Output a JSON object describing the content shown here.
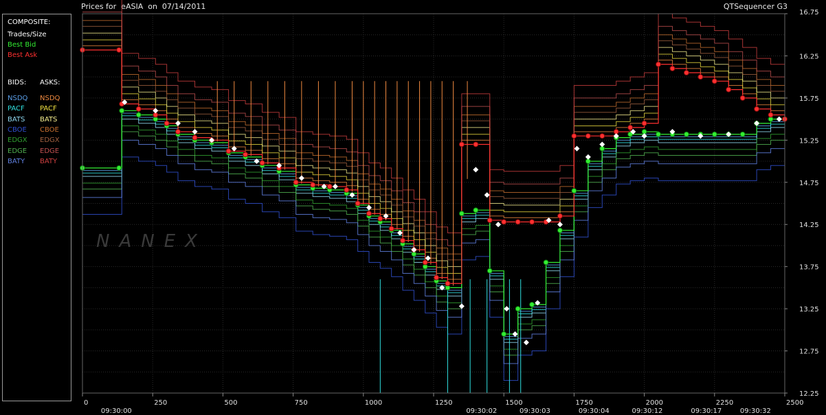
{
  "header": {
    "title": "Prices for  eASIA  on  07/14/2011",
    "app_name": "QTSequencer G3"
  },
  "legend": {
    "composite_heading": "COMPOSITE:",
    "composite_items": [
      {
        "label": "Trades/Size",
        "color": "#ffffff"
      },
      {
        "label": "Best Bid",
        "color": "#33ee33"
      },
      {
        "label": "Best Ask",
        "color": "#ff3030"
      }
    ],
    "bids_heading": "BIDS:",
    "asks_heading": "ASKS:",
    "exchanges": [
      {
        "bid": "NSDQ",
        "ask": "NSDQ",
        "bid_color": "#5a9ee8",
        "ask_color": "#f08a40"
      },
      {
        "bid": "PACF",
        "ask": "PACF",
        "bid_color": "#30e0e0",
        "ask_color": "#f0e040"
      },
      {
        "bid": "BATS",
        "ask": "BATS",
        "bid_color": "#8fd8f0",
        "ask_color": "#f8f090"
      },
      {
        "bid": "CBOE",
        "ask": "CBOE",
        "bid_color": "#3050d0",
        "ask_color": "#c87030"
      },
      {
        "bid": "EDGX",
        "ask": "EDGX",
        "bid_color": "#30a030",
        "ask_color": "#a06040"
      },
      {
        "bid": "EDGE",
        "ask": "EDGE",
        "bid_color": "#50b050",
        "ask_color": "#c05050"
      },
      {
        "bid": "BATY",
        "ask": "BATY",
        "bid_color": "#6080e0",
        "ask_color": "#d04040"
      }
    ]
  },
  "watermark": "NANEX",
  "chart_data": {
    "type": "line",
    "title": "Prices for  eASIA  on  07/14/2011",
    "xlabel": "",
    "ylabel": "",
    "xlim": [
      0,
      2500
    ],
    "ylim": [
      12.25,
      16.75
    ],
    "x_ticks": [
      0,
      250,
      500,
      750,
      1000,
      1250,
      1500,
      1750,
      2000,
      2250,
      2500
    ],
    "y_ticks": [
      12.25,
      12.75,
      13.25,
      13.75,
      14.25,
      14.75,
      15.25,
      15.75,
      16.25,
      16.75
    ],
    "time_labels": [
      {
        "x": 100,
        "label": "09:30:00"
      },
      {
        "x": 1400,
        "label": "09:30:02"
      },
      {
        "x": 1590,
        "label": "09:30:03"
      },
      {
        "x": 1800,
        "label": "09:30:04"
      },
      {
        "x": 1990,
        "label": "09:30:12"
      },
      {
        "x": 2200,
        "label": "09:30:17"
      },
      {
        "x": 2375,
        "label": "09:30:32"
      }
    ],
    "grid": true,
    "series": [
      {
        "name": "Best Bid",
        "color": "#33ee33",
        "marker": "circle",
        "x": [
          0,
          130,
          140,
          200,
          260,
          300,
          340,
          400,
          460,
          520,
          580,
          640,
          700,
          760,
          820,
          880,
          940,
          980,
          1020,
          1060,
          1100,
          1140,
          1180,
          1220,
          1260,
          1300,
          1350,
          1400,
          1450,
          1500,
          1550,
          1600,
          1650,
          1700,
          1750,
          1800,
          1850,
          1900,
          1950,
          2000,
          2050,
          2100,
          2150,
          2200,
          2250,
          2300,
          2350,
          2400,
          2450,
          2500
        ],
        "y": [
          14.92,
          14.92,
          15.6,
          15.55,
          15.5,
          15.42,
          15.32,
          15.25,
          15.22,
          15.1,
          15.05,
          14.95,
          14.88,
          14.72,
          14.68,
          14.66,
          14.62,
          14.48,
          14.35,
          14.28,
          14.18,
          14.02,
          13.9,
          13.75,
          13.58,
          13.5,
          14.38,
          14.42,
          13.7,
          12.95,
          13.25,
          13.3,
          13.8,
          14.18,
          14.65,
          15.0,
          15.15,
          15.28,
          15.32,
          15.35,
          15.32,
          15.32,
          15.32,
          15.32,
          15.32,
          15.32,
          15.32,
          15.45,
          15.5,
          15.5
        ]
      },
      {
        "name": "Best Ask",
        "color": "#ff3030",
        "marker": "circle",
        "x": [
          0,
          130,
          140,
          200,
          260,
          300,
          340,
          400,
          460,
          520,
          580,
          640,
          700,
          760,
          820,
          880,
          940,
          980,
          1020,
          1060,
          1100,
          1140,
          1180,
          1220,
          1260,
          1300,
          1350,
          1400,
          1450,
          1500,
          1550,
          1600,
          1650,
          1700,
          1750,
          1800,
          1850,
          1900,
          1950,
          2000,
          2050,
          2100,
          2150,
          2200,
          2250,
          2300,
          2350,
          2400,
          2450,
          2500
        ],
        "y": [
          16.32,
          16.32,
          15.68,
          15.62,
          15.55,
          15.45,
          15.35,
          15.28,
          15.25,
          15.12,
          15.08,
          14.98,
          14.92,
          14.75,
          14.72,
          14.7,
          14.66,
          14.5,
          14.38,
          14.32,
          14.2,
          14.06,
          13.95,
          13.8,
          13.62,
          13.55,
          15.2,
          15.2,
          14.3,
          14.28,
          14.28,
          14.28,
          14.28,
          14.35,
          15.3,
          15.3,
          15.3,
          15.35,
          15.4,
          15.45,
          16.15,
          16.1,
          16.05,
          16.0,
          15.95,
          15.85,
          15.75,
          15.62,
          15.55,
          15.5
        ]
      },
      {
        "name": "Trades/Size",
        "color": "#ffffff",
        "marker": "diamond",
        "x": [
          150,
          260,
          340,
          400,
          460,
          540,
          620,
          700,
          780,
          860,
          900,
          960,
          1020,
          1080,
          1130,
          1180,
          1230,
          1280,
          1350,
          1400,
          1440,
          1480,
          1510,
          1540,
          1580,
          1620,
          1660,
          1700,
          1760,
          1800,
          1850,
          1900,
          1960,
          2000,
          2100,
          2200,
          2300,
          2400,
          2480
        ],
        "y": [
          15.7,
          15.6,
          15.45,
          15.35,
          15.25,
          15.15,
          15.0,
          14.95,
          14.8,
          14.7,
          14.7,
          14.6,
          14.45,
          14.35,
          14.15,
          13.95,
          13.85,
          13.5,
          13.28,
          14.9,
          14.6,
          14.25,
          13.25,
          12.95,
          12.85,
          13.32,
          14.3,
          14.25,
          15.15,
          15.05,
          15.2,
          15.3,
          15.35,
          15.3,
          15.35,
          15.3,
          15.32,
          15.45,
          15.5
        ]
      }
    ]
  }
}
